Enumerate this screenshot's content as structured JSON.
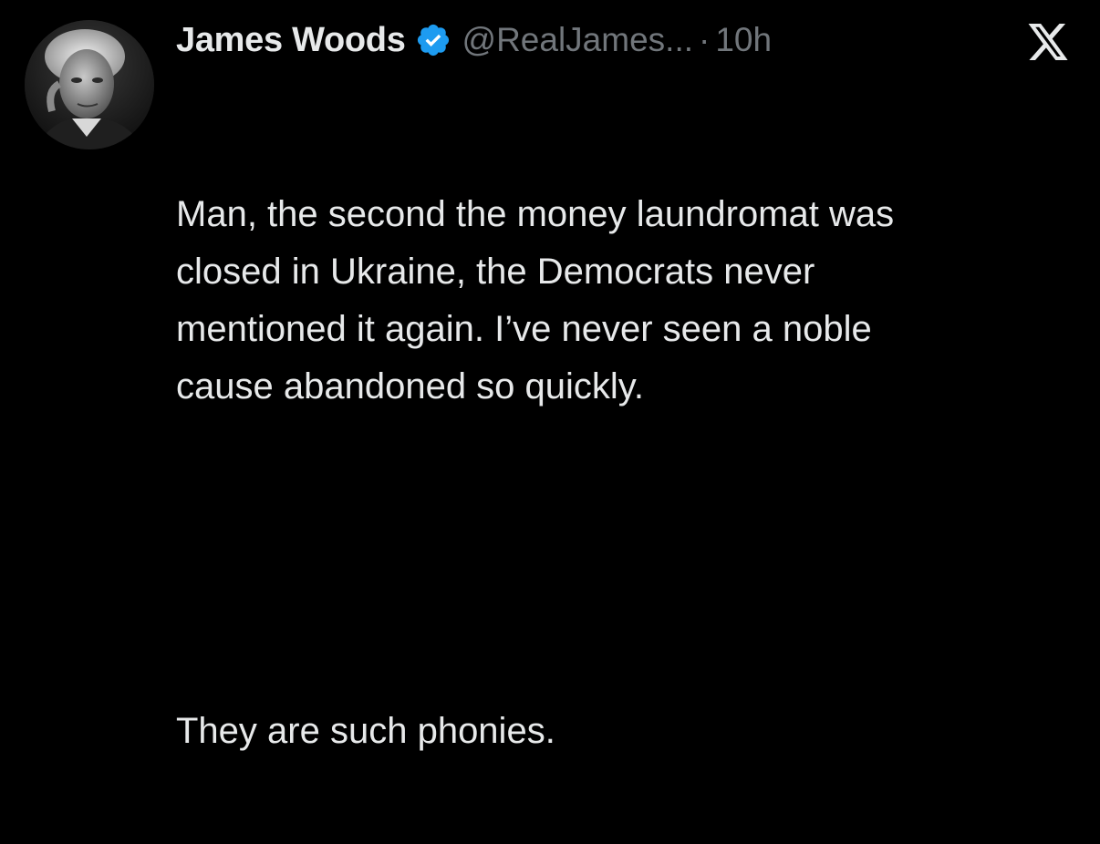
{
  "author": {
    "display_name": "James Woods",
    "handle": "@RealJames...",
    "separator": "·",
    "timestamp": "10h",
    "verified": true,
    "avatar_icon": "person-portrait-icon"
  },
  "platform": {
    "logo_icon": "x-logo-icon"
  },
  "tweet": {
    "paragraph_1": "Man, the second the money laundromat was\nclosed in Ukraine, the Democrats never\nmentioned it again. I’ve never seen a noble\ncause abandoned so quickly.",
    "paragraph_2": "They are such phonies."
  },
  "colors": {
    "background": "#000000",
    "text_primary": "#e7e9ea",
    "text_secondary": "#71767b",
    "verified_blue": "#1d9bf0"
  }
}
